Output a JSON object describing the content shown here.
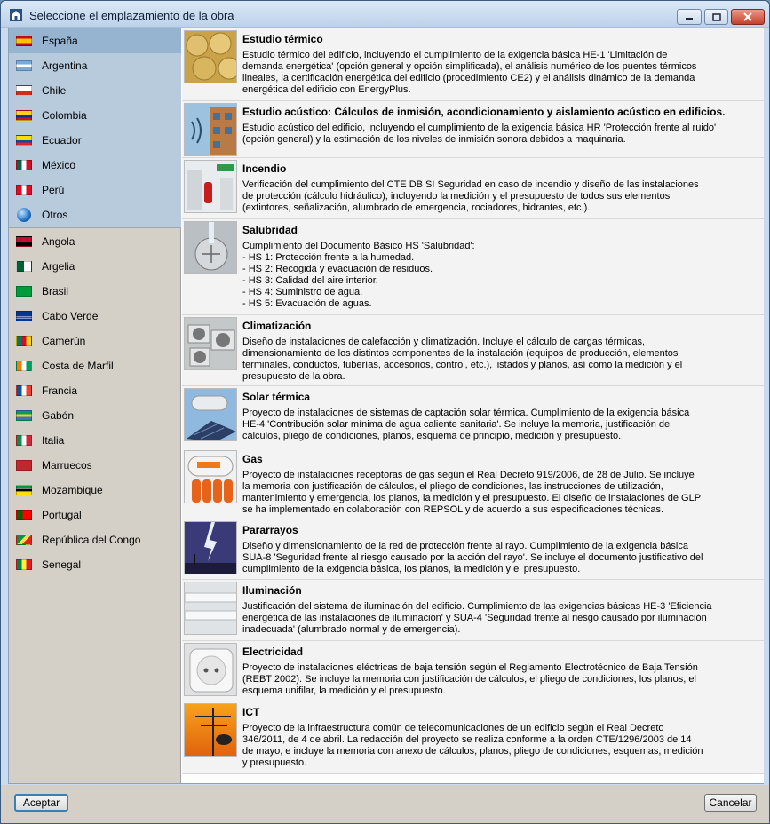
{
  "window": {
    "title": "Seleccione el emplazamiento de la obra"
  },
  "countries_top": [
    {
      "label": "España",
      "flag": "spain",
      "selected": true
    },
    {
      "label": "Argentina",
      "flag": "argentina"
    },
    {
      "label": "Chile",
      "flag": "chile"
    },
    {
      "label": "Colombia",
      "flag": "colombia"
    },
    {
      "label": "Ecuador",
      "flag": "ecuador"
    },
    {
      "label": "México",
      "flag": "mexico"
    },
    {
      "label": "Perú",
      "flag": "peru"
    },
    {
      "label": "Otros",
      "flag": "globe"
    }
  ],
  "countries_bottom": [
    {
      "label": "Angola",
      "flag": "angola"
    },
    {
      "label": "Argelia",
      "flag": "algeria"
    },
    {
      "label": "Brasil",
      "flag": "brazil"
    },
    {
      "label": "Cabo Verde",
      "flag": "cape-verde"
    },
    {
      "label": "Camerún",
      "flag": "cameroon"
    },
    {
      "label": "Costa de Marfil",
      "flag": "ivory-coast"
    },
    {
      "label": "Francia",
      "flag": "france"
    },
    {
      "label": "Gabón",
      "flag": "gabon"
    },
    {
      "label": "Italia",
      "flag": "italy"
    },
    {
      "label": "Marruecos",
      "flag": "morocco"
    },
    {
      "label": "Mozambique",
      "flag": "mozambique"
    },
    {
      "label": "Portugal",
      "flag": "portugal"
    },
    {
      "label": "República del Congo",
      "flag": "congo"
    },
    {
      "label": "Senegal",
      "flag": "senegal"
    }
  ],
  "modules": [
    {
      "title": "Estudio térmico",
      "icon": "insulation-rolls-thumbnail",
      "desc": "Estudio térmico del edificio, incluyendo el cumplimiento de la exigencia básica HE-1 'Limitación de\ndemanda energética' (opción general y opción simplificada), el análisis numérico de los puentes térmicos\nlineales, la certificación energética del edificio (procedimiento CE2) y el análisis dinámico de la demanda\nenergética del edificio con EnergyPlus."
    },
    {
      "title": "Estudio acústico: Cálculos de inmisión, acondicionamiento y aislamiento acústico en edificios.",
      "icon": "acoustic-facade-thumbnail",
      "desc": "Estudio acústico del edificio, incluyendo el cumplimiento de la exigencia básica HR 'Protección frente al ruido'\n(opción general) y la estimación de los niveles de inmisión sonora debidos a maquinaria."
    },
    {
      "title": "Incendio",
      "icon": "fire-extinguisher-thumbnail",
      "desc": "Verificación del cumplimiento del CTE DB SI Seguridad en caso de incendio y diseño de las instalaciones\nde protección (cálculo hidráulico), incluyendo la medición y el presupuesto de todos sus elementos\n(extintores, señalización, alumbrado de emergencia, rociadores, hidrantes, etc.)."
    },
    {
      "title": "Salubridad",
      "icon": "drain-water-thumbnail",
      "desc": "Cumplimiento del Documento Básico HS 'Salubridad':\n- HS 1: Protección frente a la humedad.\n- HS 2: Recogida y evacuación de residuos.\n- HS 3: Calidad del aire interior.\n- HS 4: Suministro de agua.\n- HS 5: Evacuación de aguas."
    },
    {
      "title": "Climatización",
      "icon": "hvac-units-thumbnail",
      "desc": "Diseño de instalaciones de calefacción y climatización. Incluye el cálculo de cargas térmicas,\ndimensionamiento de los distintos componentes de la instalación (equipos de producción, elementos\nterminales, conductos, tuberías, accesorios, control, etc.), listados y planos, así como la medición y el\npresupuesto de la obra."
    },
    {
      "title": "Solar térmica",
      "icon": "solar-panel-thumbnail",
      "desc": "Proyecto de instalaciones de sistemas de captación solar térmica. Cumplimiento de la exigencia básica\nHE-4 'Contribución solar mínima de agua caliente sanitaria'. Se incluye la memoria, justificación de\ncálculos, pliego de condiciones, planos, esquema de principio, medición y presupuesto."
    },
    {
      "title": "Gas",
      "icon": "gas-tank-thumbnail",
      "desc": "Proyecto de instalaciones receptoras de gas según el Real Decreto 919/2006, de 28 de Julio. Se incluye\nla memoria con justificación de cálculos, el pliego de condiciones, las instrucciones de utilización,\nmantenimiento y emergencia, los planos, la medición y el presupuesto. El diseño de instalaciones de GLP\nse ha implementado en colaboración con REPSOL y de acuerdo a sus especificaciones técnicas."
    },
    {
      "title": "Pararrayos",
      "icon": "lightning-thumbnail",
      "desc": "Diseño y dimensionamiento de la red de protección frente al rayo. Cumplimiento de la exigencia básica\nSUA-8 'Seguridad frente al riesgo causado por la acción del rayo'. Se incluye el documento justificativo del\ncumplimiento de la exigencia básica, los planos, la medición y el presupuesto."
    },
    {
      "title": "Iluminación",
      "icon": "fluorescent-lamp-thumbnail",
      "desc": "Justificación del sistema de iluminación del edificio. Cumplimiento de las exigencias básicas HE-3 'Eficiencia\nenergética de las instalaciones de iluminación' y SUA-4 'Seguridad frente al riesgo causado por iluminación\ninadecuada' (alumbrado normal y de emergencia)."
    },
    {
      "title": "Electricidad",
      "icon": "power-socket-thumbnail",
      "desc": "Proyecto de instalaciones eléctricas de baja tensión según el Reglamento Electrotécnico de Baja Tensión\n(REBT 2002). Se incluye la memoria con justificación de cálculos, el pliego de condiciones, los planos, el\nesquema unifilar, la medición y el presupuesto."
    },
    {
      "title": "ICT",
      "icon": "antenna-thumbnail",
      "desc": "Proyecto de la infraestructura común de telecomunicaciones de un edificio según el Real Decreto\n346/2011, de 4 de abril. La redacción del proyecto se realiza conforme a la orden CTE/1296/2003 de 14\nde mayo, e incluye la memoria con anexo de cálculos, planos, pliego de condiciones, esquemas, medición\ny presupuesto."
    }
  ],
  "buttons": {
    "ok": "Aceptar",
    "cancel": "Cancelar"
  }
}
